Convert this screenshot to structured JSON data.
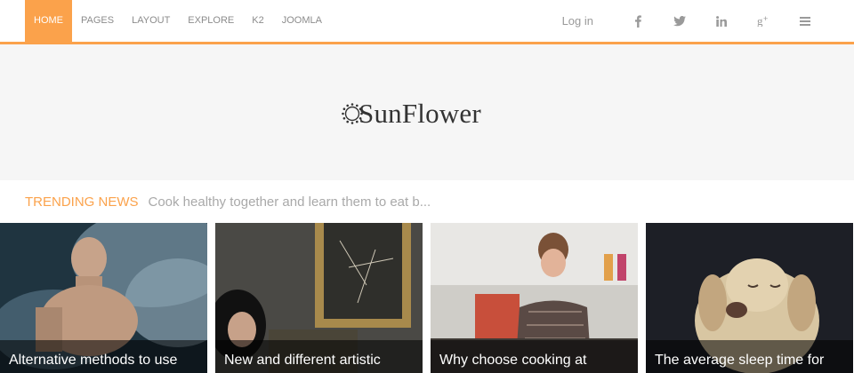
{
  "nav": {
    "items": [
      {
        "label": "HOME",
        "active": true
      },
      {
        "label": "PAGES",
        "active": false
      },
      {
        "label": "LAYOUT",
        "active": false
      },
      {
        "label": "EXPLORE",
        "active": false
      },
      {
        "label": "K2",
        "active": false
      },
      {
        "label": "JOOMLA",
        "active": false
      }
    ],
    "login": "Log in",
    "social_icons": [
      "facebook-icon",
      "twitter-icon",
      "linkedin-icon",
      "google-plus-icon",
      "menu-icon"
    ]
  },
  "logo": {
    "text": "SunFlower"
  },
  "trending": {
    "label": "TRENDING NEWS",
    "headline": "Cook healthy together and learn them to eat b..."
  },
  "articles": [
    {
      "title": "Alternative methods to use"
    },
    {
      "title": "New and different artistic"
    },
    {
      "title": "Why choose cooking at"
    },
    {
      "title": "The average sleep time for"
    }
  ],
  "colors": {
    "accent": "#fba24b",
    "header_bg": "#f6f6f6"
  }
}
